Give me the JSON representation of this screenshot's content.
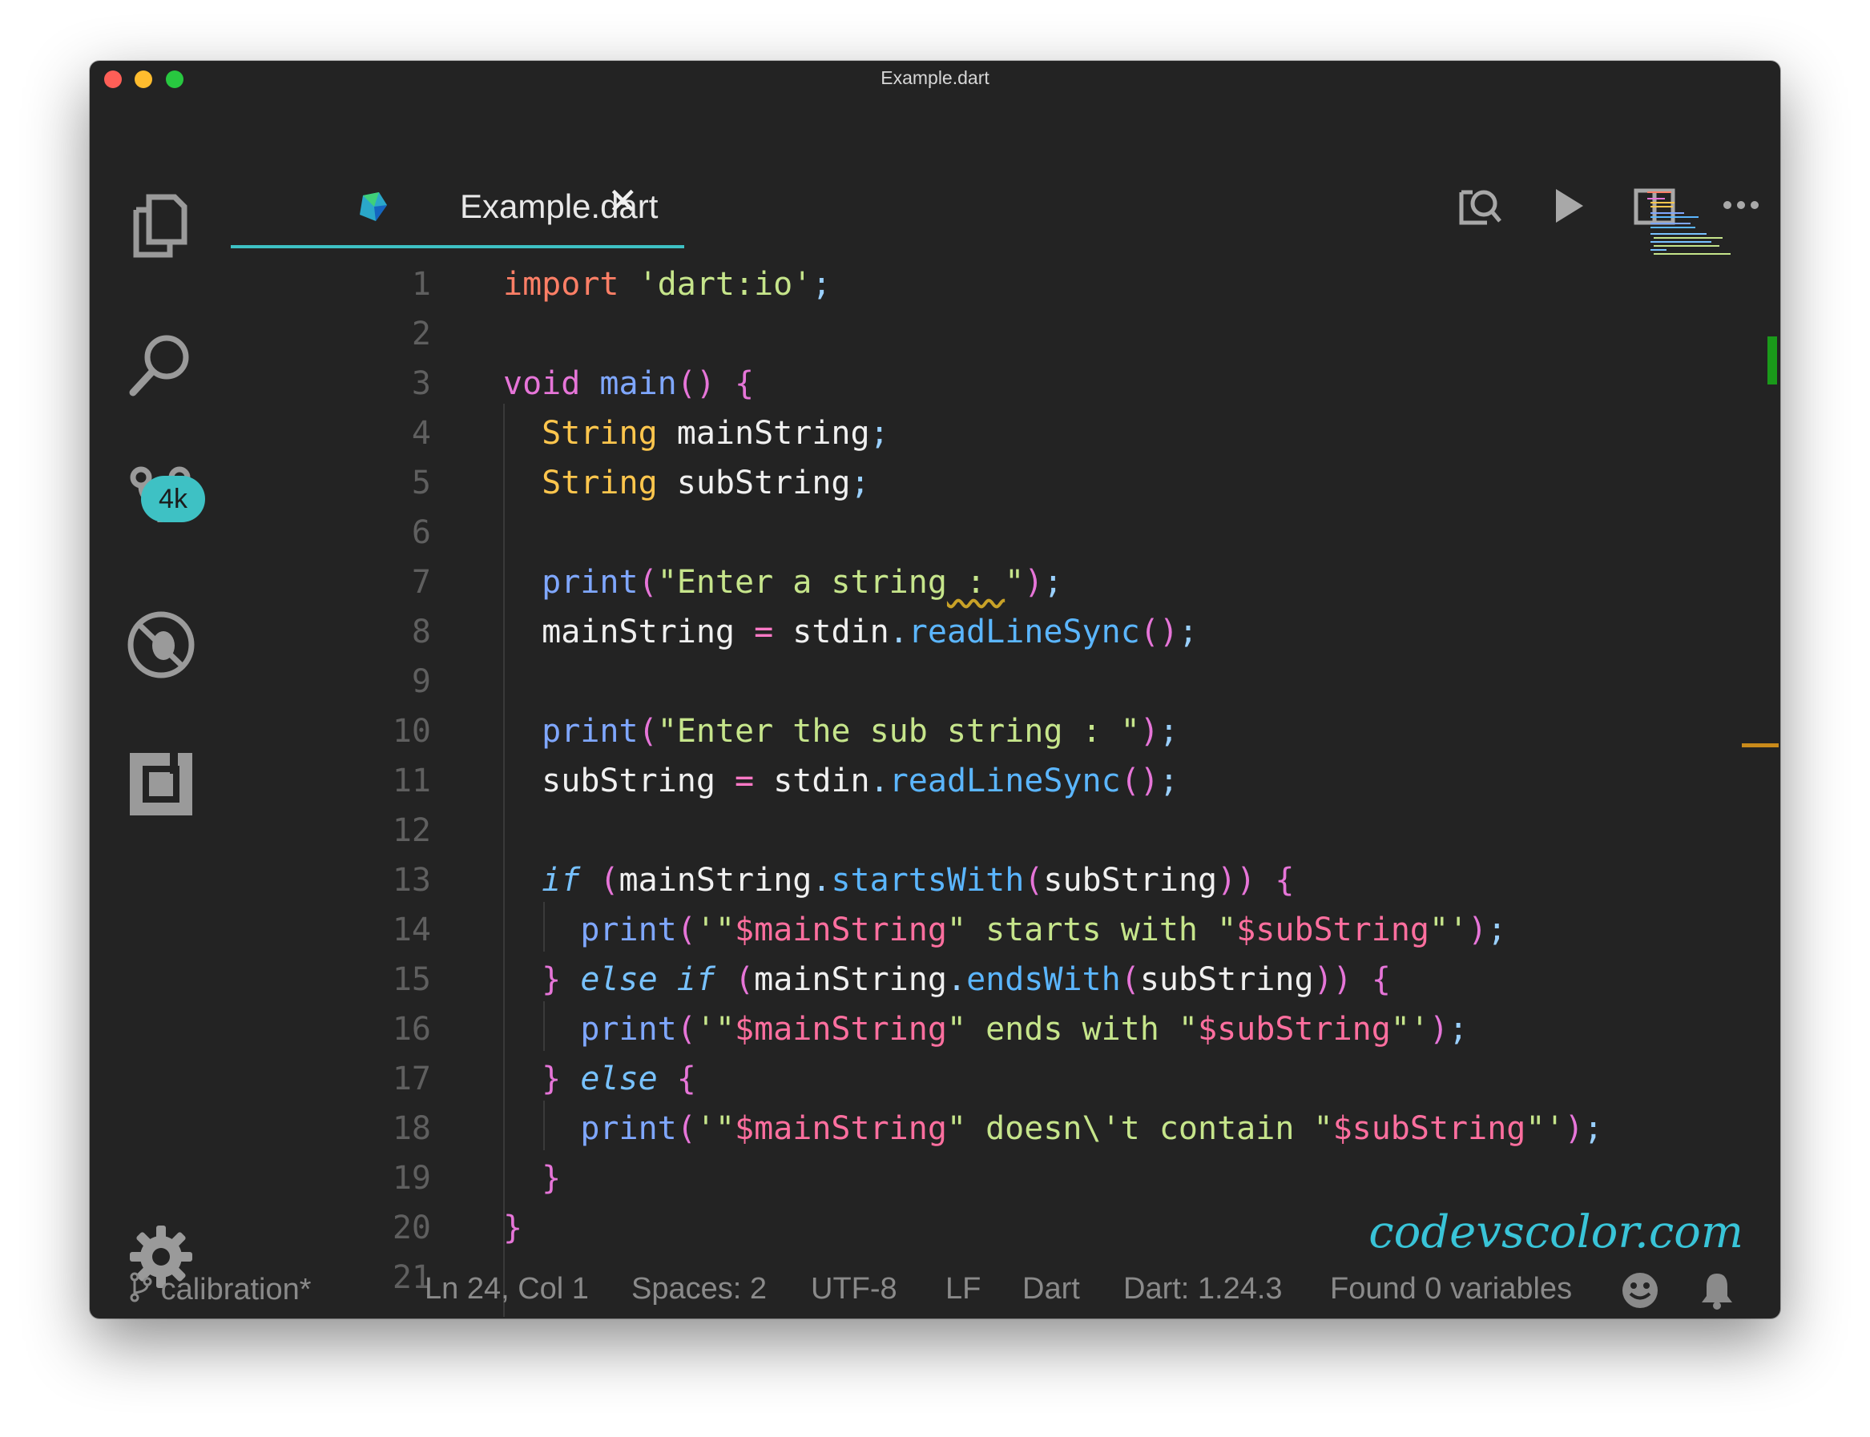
{
  "window": {
    "title": "Example.dart"
  },
  "activity_bar": {
    "items": [
      {
        "name": "explorer-icon"
      },
      {
        "name": "search-icon"
      },
      {
        "name": "source-control-icon"
      },
      {
        "name": "debug-icon"
      },
      {
        "name": "extensions-icon"
      },
      {
        "name": "settings-gear-icon"
      }
    ],
    "source_control_badge": "4k"
  },
  "tab": {
    "label": "Example.dart",
    "close": "✕",
    "icon": "dart-icon"
  },
  "toolbar": {
    "icons": [
      "open-preview-icon",
      "run-icon",
      "split-editor-icon",
      "more-actions-icon"
    ]
  },
  "editor": {
    "language": "dart",
    "line_numbers": [
      "1",
      "2",
      "3",
      "4",
      "5",
      "6",
      "7",
      "8",
      "9",
      "10",
      "11",
      "12",
      "13",
      "14",
      "15",
      "16",
      "17",
      "18",
      "19",
      "20",
      "21"
    ],
    "lines": [
      "import 'dart:io';",
      "",
      "void main() {",
      "  String mainString;",
      "  String subString;",
      "",
      "  print(\"Enter a string : \");",
      "  mainString = stdin.readLineSync();",
      "",
      "  print(\"Enter the sub string : \");",
      "  subString = stdin.readLineSync();",
      "",
      "  if (mainString.startsWith(subString)) {",
      "    print('\"$mainString\" starts with \"$subString\"');",
      "  } else if (mainString.endsWith(subString)) {",
      "    print('\"$mainString\" ends with \"$subString\"');",
      "  } else {",
      "    print('\"$mainString\" doesn\\'t contain \"$subString\"');",
      "  }",
      "}",
      ""
    ]
  },
  "watermark": "codevscolor.com",
  "statusbar": {
    "branch": "calibration*",
    "position": "Ln 24, Col 1",
    "spaces": "Spaces: 2",
    "encoding": "UTF-8",
    "eol": "LF",
    "language": "Dart",
    "dart_version": "Dart: 1.24.3",
    "variables": "Found 0 variables",
    "icons": [
      "branch-icon",
      "feedback-smiley-icon",
      "notifications-bell-icon"
    ]
  },
  "colors": {
    "background": "#232323",
    "accent": "#3ec1c4",
    "keyword": "#ff7f66",
    "string": "#c6e58b",
    "type": "#ffc64d",
    "function": "#7fa7ff",
    "control": "#78c2ff",
    "watermark": "#39c4d8"
  }
}
